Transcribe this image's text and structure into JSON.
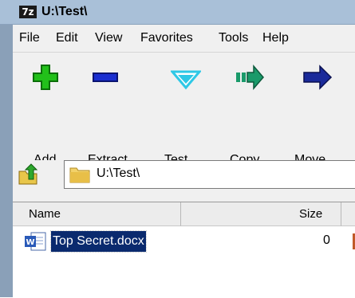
{
  "window": {
    "title": "U:\\Test\\",
    "app_icon_text": "7z"
  },
  "menu": [
    "File",
    "Edit",
    "View",
    "Favorites",
    "Tools",
    "Help"
  ],
  "toolbar": [
    {
      "label": "Add",
      "icon": "plus-icon",
      "color": "#22c01a"
    },
    {
      "label": "Extract",
      "icon": "minus-icon",
      "color": "#1a2ed0"
    },
    {
      "label": "Test",
      "icon": "check-icon",
      "color": "#2ec8e6"
    },
    {
      "label": "Copy",
      "icon": "copy-arrow-icon",
      "color": "#1a9a6a"
    },
    {
      "label": "Move",
      "icon": "move-arrow-icon",
      "color": "#1a2a9a"
    }
  ],
  "address": {
    "path": "U:\\Test\\"
  },
  "columns": {
    "name": "Name",
    "size": "Size"
  },
  "files": [
    {
      "name": "Top Secret.docx",
      "size": "0"
    }
  ]
}
